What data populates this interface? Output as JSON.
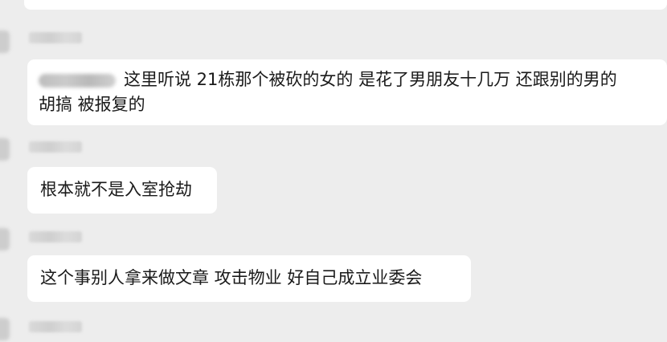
{
  "messages": [
    {
      "text_line1": "这里听说 21栋那个被砍的女的 是花了男朋友十几万  还跟别的男的",
      "text_line2": "胡搞 被报复的"
    },
    {
      "text": "根本就不是入室抢劫"
    },
    {
      "text": "这个事别人拿来做文章 攻击物业 好自己成立业委会"
    }
  ]
}
